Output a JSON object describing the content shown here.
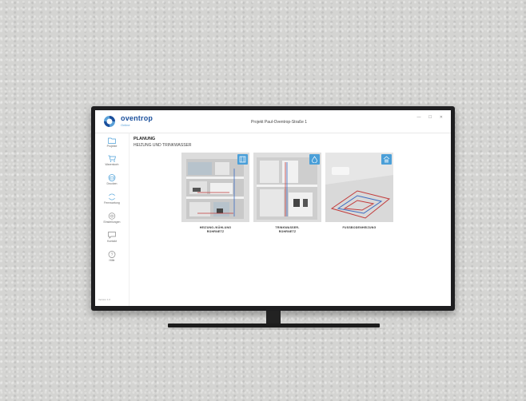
{
  "app": {
    "brand": "oventrop",
    "brand_sub": "Online",
    "project_title": "Projekt Paul-Oventrop-Straße 1",
    "window_controls": "— ☐ ✕"
  },
  "sidebar": {
    "items": [
      {
        "label": "Projekte",
        "icon": "folder-icon"
      },
      {
        "label": "Warenkorb",
        "icon": "cart-icon"
      },
      {
        "label": "Drucken",
        "icon": "print-icon"
      },
      {
        "label": "Fernwartung",
        "icon": "sync-icon"
      },
      {
        "label": "Einstellungen",
        "icon": "gear-icon"
      },
      {
        "label": "Kontakt",
        "icon": "chat-icon"
      },
      {
        "label": "Hilfe",
        "icon": "help-icon"
      }
    ],
    "version": "Version 1.0"
  },
  "main": {
    "heading": "PLANUNG",
    "subheading": "HEIZUNG UND TRINKWASSER",
    "tiles": [
      {
        "line1": "HEIZUNG-/KÜHLUNG",
        "line2": "ROHRNETZ",
        "icon": "radiator-icon"
      },
      {
        "line1": "TRINKWASSER-",
        "line2": "ROHRNETZ",
        "icon": "water-drop-icon"
      },
      {
        "line1": "FUSSBODENHEIZUNG",
        "line2": "",
        "icon": "floor-heating-icon"
      }
    ]
  },
  "colors": {
    "brand": "#1a4f9c",
    "accent": "#4a9fd8"
  }
}
